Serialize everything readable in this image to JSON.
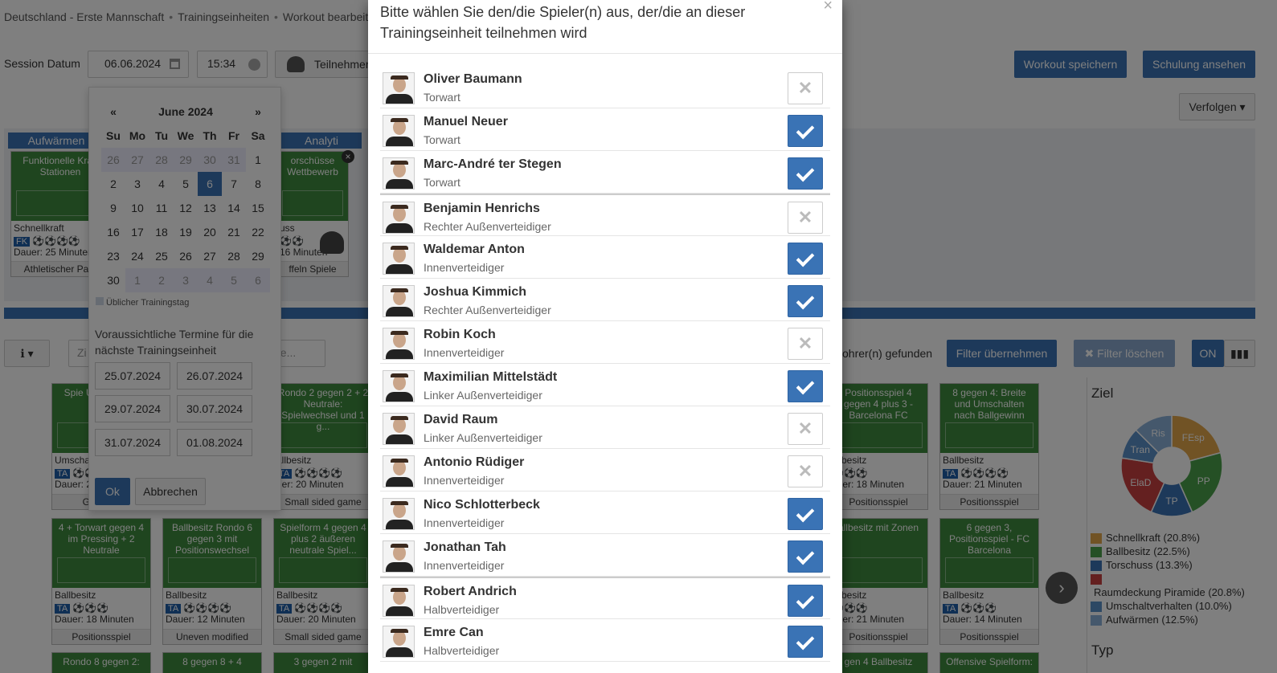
{
  "breadcrumb": [
    "Deutschland - Erste Mannschaft",
    "Trainingseinheiten",
    "Workout bearbeiten"
  ],
  "session": {
    "label": "Session Datum",
    "date": "06.06.2024",
    "time": "15:34",
    "participants_button": "Teilnehmer"
  },
  "header_buttons": {
    "save": "Workout speichern",
    "view": "Schulung ansehen",
    "follow": "Verfolgen"
  },
  "sections": {
    "warmup": "Aufwärmen",
    "analytics": "Analyti"
  },
  "calendar": {
    "prev": "«",
    "next": "»",
    "month": "June 2024",
    "weekdays": [
      "Su",
      "Mo",
      "Tu",
      "We",
      "Th",
      "Fr",
      "Sa"
    ],
    "weeks": [
      [
        "26",
        "27",
        "28",
        "29",
        "30",
        "31",
        "1"
      ],
      [
        "2",
        "3",
        "4",
        "5",
        "6",
        "7",
        "8"
      ],
      [
        "9",
        "10",
        "11",
        "12",
        "13",
        "14",
        "15"
      ],
      [
        "16",
        "17",
        "18",
        "19",
        "20",
        "21",
        "22"
      ],
      [
        "23",
        "24",
        "25",
        "26",
        "27",
        "28",
        "29"
      ],
      [
        "30",
        "1",
        "2",
        "3",
        "4",
        "5",
        "6"
      ]
    ],
    "selected": "6",
    "legend": "Üblicher Trainingstag",
    "next_text": "Voraussichtliche Termine für die nächste Trainingseinheit",
    "suggestions": [
      "25.07.2024",
      "26.07.2024",
      "29.07.2024",
      "30.07.2024",
      "31.07.2024",
      "01.08.2024"
    ],
    "ok": "Ok",
    "cancel": "Abbrechen"
  },
  "top_cards": [
    {
      "title": "Funktionelle Kraft Stationen",
      "category": "Schnellkraft",
      "tag": "FK",
      "duration": "Dauer: 25 Minuten",
      "footer": "Athletischer Parc"
    },
    {
      "title": "orschüsse Wettbewerb",
      "category": "uss",
      "tag": "",
      "duration": "16 Minuten",
      "footer": "ffeln Spiele"
    }
  ],
  "filter": {
    "found": "ohrer(n) gefunden",
    "apply": "Filter übernehmen",
    "clear": "Filter löschen",
    "on": "ON",
    "search_prefix": "Zi",
    "search_placeholder": "he..."
  },
  "grid_cards": [
    {
      "title": "Spie Umsc Borus",
      "category": "Umscha",
      "tag": "TA",
      "duration": "Dauer: 2",
      "footer": "Game re"
    },
    {
      "title": "Rondo 2 gegen 2 + 2 Neutrale: Spielwechsel und 1 g...",
      "category": "allbesitz",
      "tag": "TA",
      "duration": "uer: 20 Minuten",
      "footer": "Small sided game"
    },
    {
      "title": "Positionsspiel 4 gegen 4 plus 3 - Barcelona FC",
      "category": "allbesitz",
      "tag": "",
      "duration": "auer: 18 Minuten",
      "footer": "Positionsspiel"
    },
    {
      "title": "8 gegen 4: Breite und Umschalten nach Ballgewinn",
      "category": "Ballbesitz",
      "tag": "TA",
      "duration": "Dauer: 21 Minuten",
      "footer": "Positionsspiel"
    },
    {
      "title": "4 + Torwart gegen 4 im Pressing + 2 Neutrale",
      "category": "Ballbesitz",
      "tag": "TA",
      "duration": "Dauer: 18 Minuten",
      "footer": "Positionsspiel"
    },
    {
      "title": "Ballbesitz Rondo 6 gegen 3 mit Positionswechsel",
      "category": "Ballbesitz",
      "tag": "TA",
      "duration": "Dauer: 12 Minuten",
      "footer": "Uneven modified"
    },
    {
      "title": "Spielform 4 gegen 4 plus 2 äußeren neutrale Spiel...",
      "category": "Ballbesitz",
      "tag": "TA",
      "duration": "Dauer: 20 Minuten",
      "footer": "Small sided game"
    },
    {
      "title": "allbesitz mit Zonen",
      "category": "allbesitz",
      "tag": "",
      "duration": "auer: 21 Minuten",
      "footer": "Positionsspiel"
    },
    {
      "title": "6 gegen 3, Positionsspiel - FC Barcelona",
      "category": "Ballbesitz",
      "tag": "TA",
      "duration": "Dauer: 14 Minuten",
      "footer": "Positionsspiel"
    }
  ],
  "bottom_card_titles": [
    "Rondo 8 gegen 2:",
    "8 gegen 8 + 4",
    "3 gegen 2 mit",
    "gen 4 Ballbesitz",
    "Offensive Spielform:"
  ],
  "chart_data": {
    "type": "pie",
    "title": "Ziel",
    "categories": [
      "Schnellkraft",
      "Ballbesitz",
      "Torschuss",
      "Raumdeckung Piramide",
      "Umschaltverhalten",
      "Aufwärmen"
    ],
    "labels": [
      "FEsp",
      "PP",
      "TP",
      "ElaD",
      "Tran",
      "Ris"
    ],
    "values": [
      20.8,
      22.5,
      13.3,
      20.8,
      10.0,
      12.5
    ],
    "colors": [
      "#e3a64a",
      "#4aa04a",
      "#3a73b5",
      "#c94040",
      "#5a90c8",
      "#8ab0d8"
    ],
    "legend": [
      "Schnellkraft (20.8%)",
      "Ballbesitz (22.5%)",
      "Torschuss (13.3%)",
      "Raumdeckung Piramide (20.8%)",
      "Umschaltverhalten (10.0%)",
      "Aufwärmen (12.5%)"
    ]
  },
  "typ_label": "Typ",
  "modal": {
    "title": "Bitte wählen Sie den/die Spieler(n) aus, der/die an dieser Trainingseinheit teilnehmen wird",
    "close": "×",
    "players": [
      {
        "name": "Oliver Baumann",
        "position": "Torwart",
        "selected": false,
        "group_start": false
      },
      {
        "name": "Manuel Neuer",
        "position": "Torwart",
        "selected": true,
        "group_start": false
      },
      {
        "name": "Marc-André ter Stegen",
        "position": "Torwart",
        "selected": true,
        "group_start": false
      },
      {
        "name": "Benjamin Henrichs",
        "position": "Rechter Außenverteidiger",
        "selected": false,
        "group_start": true
      },
      {
        "name": "Waldemar Anton",
        "position": "Innenverteidiger",
        "selected": true,
        "group_start": false
      },
      {
        "name": "Joshua Kimmich",
        "position": "Rechter Außenverteidiger",
        "selected": true,
        "group_start": false
      },
      {
        "name": "Robin Koch",
        "position": "Innenverteidiger",
        "selected": false,
        "group_start": false
      },
      {
        "name": "Maximilian Mittelstädt",
        "position": "Linker Außenverteidiger",
        "selected": true,
        "group_start": false
      },
      {
        "name": "David Raum",
        "position": "Linker Außenverteidiger",
        "selected": false,
        "group_start": false
      },
      {
        "name": "Antonio Rüdiger",
        "position": "Innenverteidiger",
        "selected": false,
        "group_start": false
      },
      {
        "name": "Nico Schlotterbeck",
        "position": "Innenverteidiger",
        "selected": true,
        "group_start": false
      },
      {
        "name": "Jonathan Tah",
        "position": "Innenverteidiger",
        "selected": true,
        "group_start": false
      },
      {
        "name": "Robert Andrich",
        "position": "Halbverteidiger",
        "selected": true,
        "group_start": true
      },
      {
        "name": "Emre Can",
        "position": "Halbverteidiger",
        "selected": true,
        "group_start": false
      }
    ]
  }
}
